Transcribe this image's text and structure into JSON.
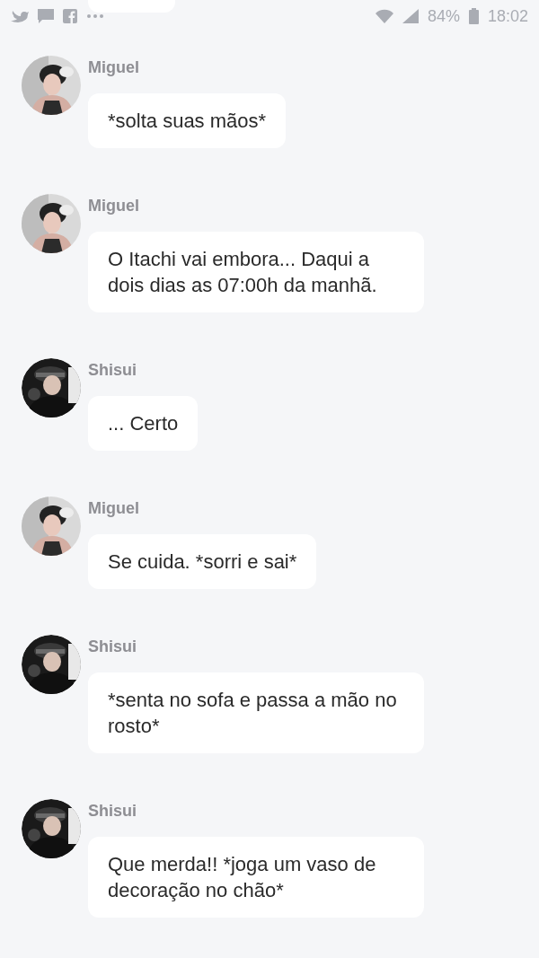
{
  "status_bar": {
    "battery": "84%",
    "time": "18:02"
  },
  "messages": [
    {
      "kind": "pale",
      "author": "Miguel",
      "text": "*solta suas mãos*"
    },
    {
      "kind": "pale",
      "author": "Miguel",
      "text": "O Itachi vai embora... Daqui a dois dias as 07:00h da manhã."
    },
    {
      "kind": "dark",
      "author": "Shisui",
      "text": "... Certo"
    },
    {
      "kind": "pale",
      "author": "Miguel",
      "text": "Se cuida. *sorri e sai*"
    },
    {
      "kind": "dark",
      "author": "Shisui",
      "text": "*senta no sofa e passa a mão no rosto*"
    },
    {
      "kind": "dark",
      "author": "Shisui",
      "text": "Que merda!! *joga um vaso de decoração no chão*"
    }
  ]
}
